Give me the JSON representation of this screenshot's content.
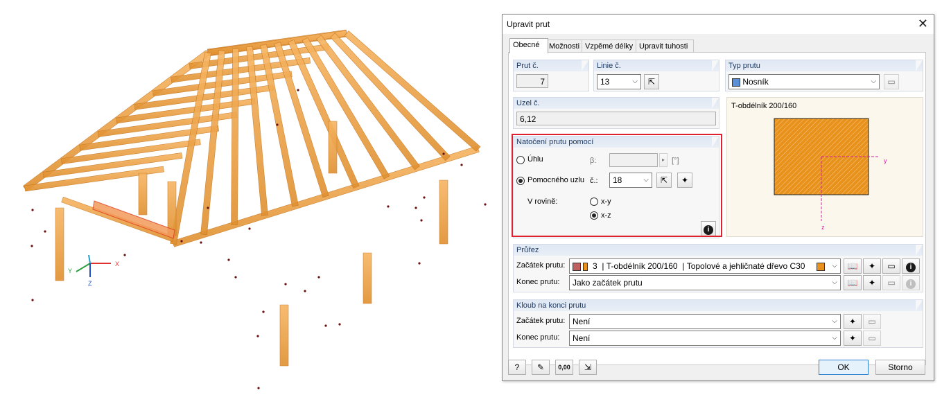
{
  "dialog": {
    "title": "Upravit prut",
    "close_glyph": "✕",
    "tabs": [
      {
        "label": "Obecné",
        "active": true
      },
      {
        "label": "Možnosti",
        "active": false
      },
      {
        "label": "Vzpěmé délky",
        "active": false
      },
      {
        "label": "Upravit tuhosti",
        "active": false
      }
    ]
  },
  "member": {
    "number_label": "Prut č.",
    "number": "7",
    "line_label": "Linie č.",
    "line": "13",
    "node_label": "Uzel č.",
    "nodes": "6,12"
  },
  "member_type": {
    "label": "Typ prutu",
    "value": "Nosník",
    "color": "#5b8fd6"
  },
  "preview": {
    "title": "T-obdélník 200/160",
    "axis_y": "y",
    "axis_z": "z",
    "fill_color": "#e8921c"
  },
  "rotation": {
    "header": "Natočení prutu pomocí",
    "angle_label": "Úhlu",
    "beta_label": "β:",
    "beta_unit": "[°]",
    "helper_node_label": "Pomocného uzlu",
    "node_no_label": "č.:",
    "node_no": "18",
    "plane_label": "V rovině:",
    "plane_xy": "x-y",
    "plane_xz": "x-z",
    "selected_mode": "helper_node",
    "selected_plane": "x-z"
  },
  "cross_section": {
    "header": "Průřez",
    "start_label": "Začátek prutu:",
    "start_number": "3",
    "start_name": "T-obdélník 200/160",
    "start_material": "Topolové a jehličnaté dřevo C30",
    "start_color": "#c06060",
    "material_color": "#e8921c",
    "end_label": "Konec prutu:",
    "end_value": "Jako začátek prutu"
  },
  "hinge": {
    "header": "Kloub na konci prutu",
    "start_label": "Začátek prutu:",
    "start_value": "Není",
    "end_label": "Konec prutu:",
    "end_value": "Není"
  },
  "footer": {
    "ok": "OK",
    "cancel": "Storno",
    "units_label": "0,00"
  },
  "scene": {
    "axis_x": "X",
    "axis_y": "Y",
    "axis_z": "Z",
    "wood_color": "#f0a040"
  }
}
